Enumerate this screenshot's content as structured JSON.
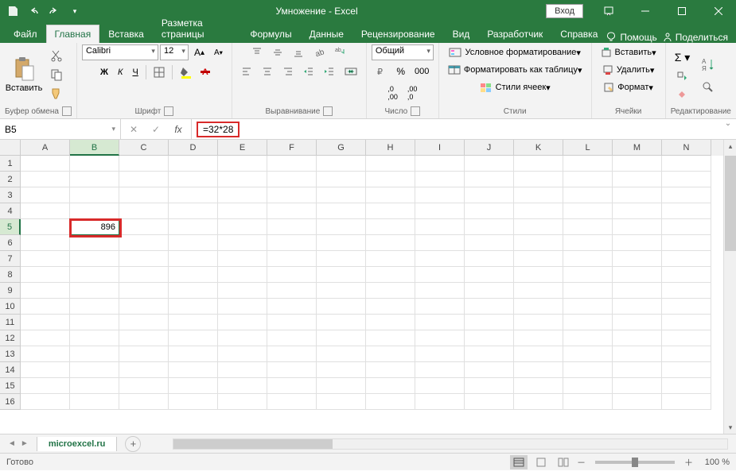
{
  "title": "Умножение - Excel",
  "login_label": "Вход",
  "tabs": {
    "file": "Файл",
    "home": "Главная",
    "insert": "Вставка",
    "layout": "Разметка страницы",
    "formulas": "Формулы",
    "data": "Данные",
    "review": "Рецензирование",
    "view": "Вид",
    "developer": "Разработчик",
    "help": "Справка"
  },
  "tabs_right": {
    "help": "Помощь",
    "share": "Поделиться"
  },
  "ribbon": {
    "clipboard": {
      "label": "Буфер обмена",
      "paste": "Вставить"
    },
    "font": {
      "label": "Шрифт",
      "name": "Calibri",
      "size": "12",
      "bold": "Ж",
      "italic": "К",
      "underline": "Ч"
    },
    "alignment": {
      "label": "Выравнивание"
    },
    "number": {
      "label": "Число",
      "format": "Общий"
    },
    "styles": {
      "label": "Стили",
      "conditional": "Условное форматирование",
      "table": "Форматировать как таблицу",
      "cell": "Стили ячеек"
    },
    "cells": {
      "label": "Ячейки",
      "insert": "Вставить",
      "delete": "Удалить",
      "format": "Формат"
    },
    "editing": {
      "label": "Редактирование"
    }
  },
  "formula_bar": {
    "name_box": "B5",
    "formula": "=32*28"
  },
  "grid": {
    "columns": [
      "A",
      "B",
      "C",
      "D",
      "E",
      "F",
      "G",
      "H",
      "I",
      "J",
      "K",
      "L",
      "M",
      "N"
    ],
    "row_count": 16,
    "active_cell": {
      "row": 5,
      "col": "B",
      "value": "896"
    }
  },
  "sheet": {
    "name": "microexcel.ru"
  },
  "status": {
    "ready": "Готово",
    "zoom": "100 %"
  }
}
